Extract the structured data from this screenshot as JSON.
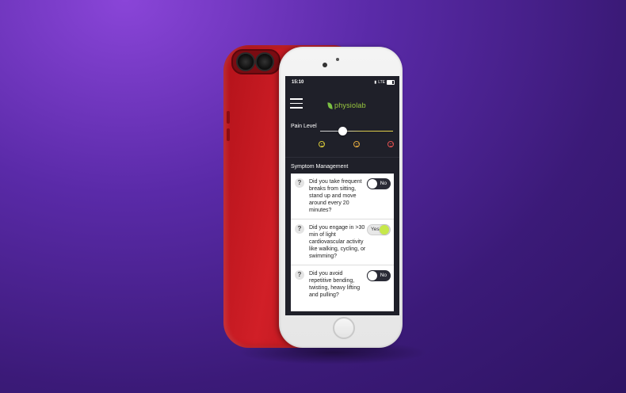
{
  "status_bar": {
    "time": "15:10",
    "network": "LTE"
  },
  "app": {
    "brand": "physiolab",
    "accent_color": "#9ccc3f"
  },
  "pain": {
    "label": "Pain Level",
    "level": 0.3,
    "faces": [
      {
        "icon": "happy-face-icon",
        "color": "#d7c83a"
      },
      {
        "icon": "neutral-face-icon",
        "color": "#e0a840"
      },
      {
        "icon": "sad-face-icon",
        "color": "#e05050"
      }
    ]
  },
  "symptom": {
    "title": "Symptom Management",
    "questions": [
      {
        "text": "Did you take frequent breaks from sitting, stand up and move around every 20 minutes?",
        "answer": "No",
        "on": false
      },
      {
        "text": "Did you engage in >30 min of light cardiovascular activity like walking, cycling, or swimming?",
        "answer": "Yes",
        "on": true
      },
      {
        "text": "Did you avoid repetitive bending, twisting, heavy lifting and pulling?",
        "answer": "No",
        "on": false
      }
    ]
  }
}
